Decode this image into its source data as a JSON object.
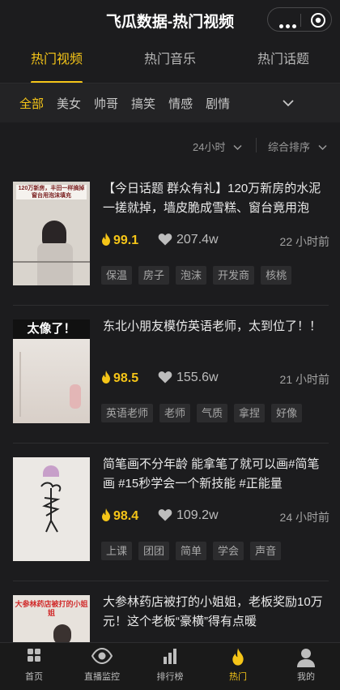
{
  "app": {
    "title": "飞瓜数据-热门视频"
  },
  "main_tabs": [
    {
      "label": "热门视频",
      "active": true
    },
    {
      "label": "热门音乐",
      "active": false
    },
    {
      "label": "热门话题",
      "active": false
    }
  ],
  "categories": [
    "全部",
    "美女",
    "帅哥",
    "搞笑",
    "情感",
    "剧情"
  ],
  "sort": {
    "time": "24小时",
    "rank": "综合排序"
  },
  "videos": [
    {
      "thumb_text": "120万新房，丰田一样搞掉 窗台用泡沫填充",
      "title": "【今日话题 群众有礼】120万新房的水泥一搓就掉，墙皮脆成雪糕、窗台竟用泡沫…",
      "heat": "99.1",
      "likes": "207.4w",
      "time": "22 小时前",
      "tags": [
        "保温",
        "房子",
        "泡沫",
        "开发商",
        "核桃"
      ]
    },
    {
      "thumb_text": "太像了！",
      "title": "东北小朋友模仿英语老师，太到位了！！",
      "heat": "98.5",
      "likes": "155.6w",
      "time": "21 小时前",
      "tags": [
        "英语老师",
        "老师",
        "气质",
        "拿捏",
        "好像"
      ]
    },
    {
      "thumb_text": "",
      "title": "简笔画不分年龄 能拿笔了就可以画#简笔画 #15秒学会一个新技能 #正能量",
      "heat": "98.4",
      "likes": "109.2w",
      "time": "24 小时前",
      "tags": [
        "上课",
        "团团",
        "简单",
        "学会",
        "声音"
      ]
    },
    {
      "thumb_text": "大参林药店被打的小姐姐",
      "title": "大参林药店被打的小姐姐，老板奖励10万元！这个老板“豪横”得有点暖",
      "heat": "",
      "likes": "",
      "time": "",
      "tags": []
    }
  ],
  "bottom_nav": [
    {
      "label": "首页",
      "icon": "grid-icon",
      "active": false
    },
    {
      "label": "直播监控",
      "icon": "eye-icon",
      "active": false
    },
    {
      "label": "排行榜",
      "icon": "bar-chart-icon",
      "active": false
    },
    {
      "label": "热门",
      "icon": "flame-icon",
      "active": true
    },
    {
      "label": "我的",
      "icon": "user-icon",
      "active": false
    }
  ],
  "colors": {
    "accent": "#f5c518",
    "background": "#1c1c1e",
    "tag_bg": "#2c2c2e"
  }
}
